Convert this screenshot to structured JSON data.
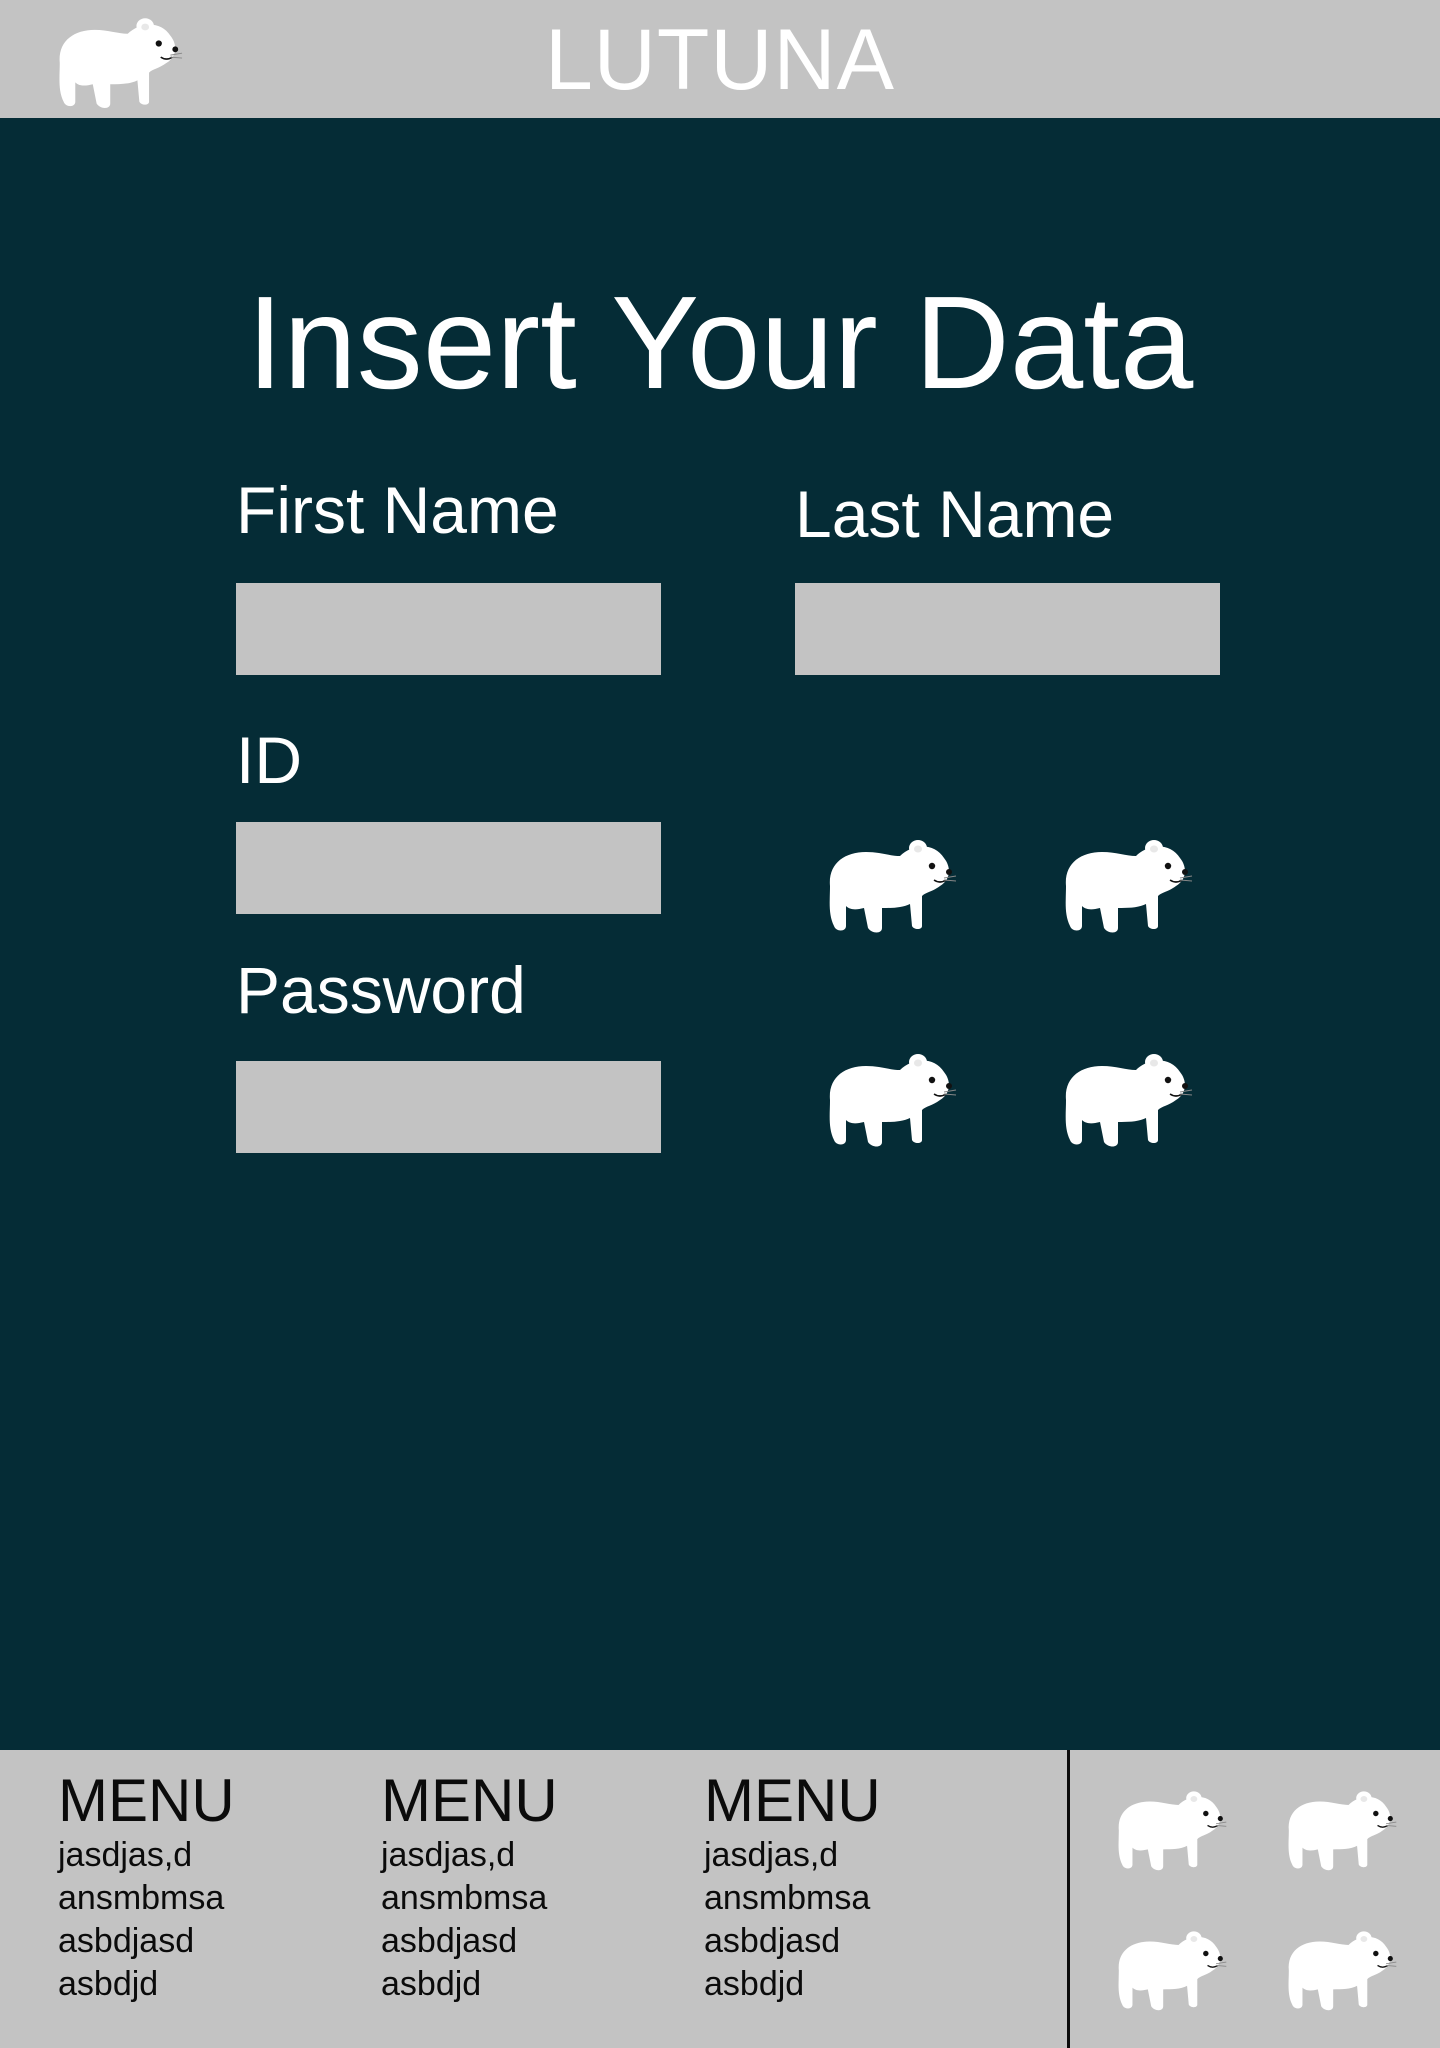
{
  "header": {
    "title": "LUTUNA",
    "logo_icon": "polar-bear-icon"
  },
  "main": {
    "heading": "Insert Your Data",
    "fields": {
      "first_name": {
        "label": "First Name",
        "value": ""
      },
      "last_name": {
        "label": "Last Name",
        "value": ""
      },
      "id": {
        "label": "ID",
        "value": ""
      },
      "password": {
        "label": "Password",
        "value": ""
      }
    },
    "decor_icon": "polar-bear-icon"
  },
  "footer": {
    "menus": [
      {
        "title": "MENU",
        "items": [
          "jasdjas,d",
          "ansmbmsa",
          "asbdjasd",
          "asbdjd"
        ]
      },
      {
        "title": "MENU",
        "items": [
          "jasdjas,d",
          "ansmbmsa",
          "asbdjasd",
          "asbdjd"
        ]
      },
      {
        "title": "MENU",
        "items": [
          "jasdjas,d",
          "ansmbmsa",
          "asbdjasd",
          "asbdjd"
        ]
      }
    ]
  },
  "colors": {
    "background": "#052c36",
    "header_footer": "#c3c3c3",
    "input_fill": "#c3c3c3",
    "text_light": "#ffffff",
    "text_dark": "#0b0b0b"
  }
}
